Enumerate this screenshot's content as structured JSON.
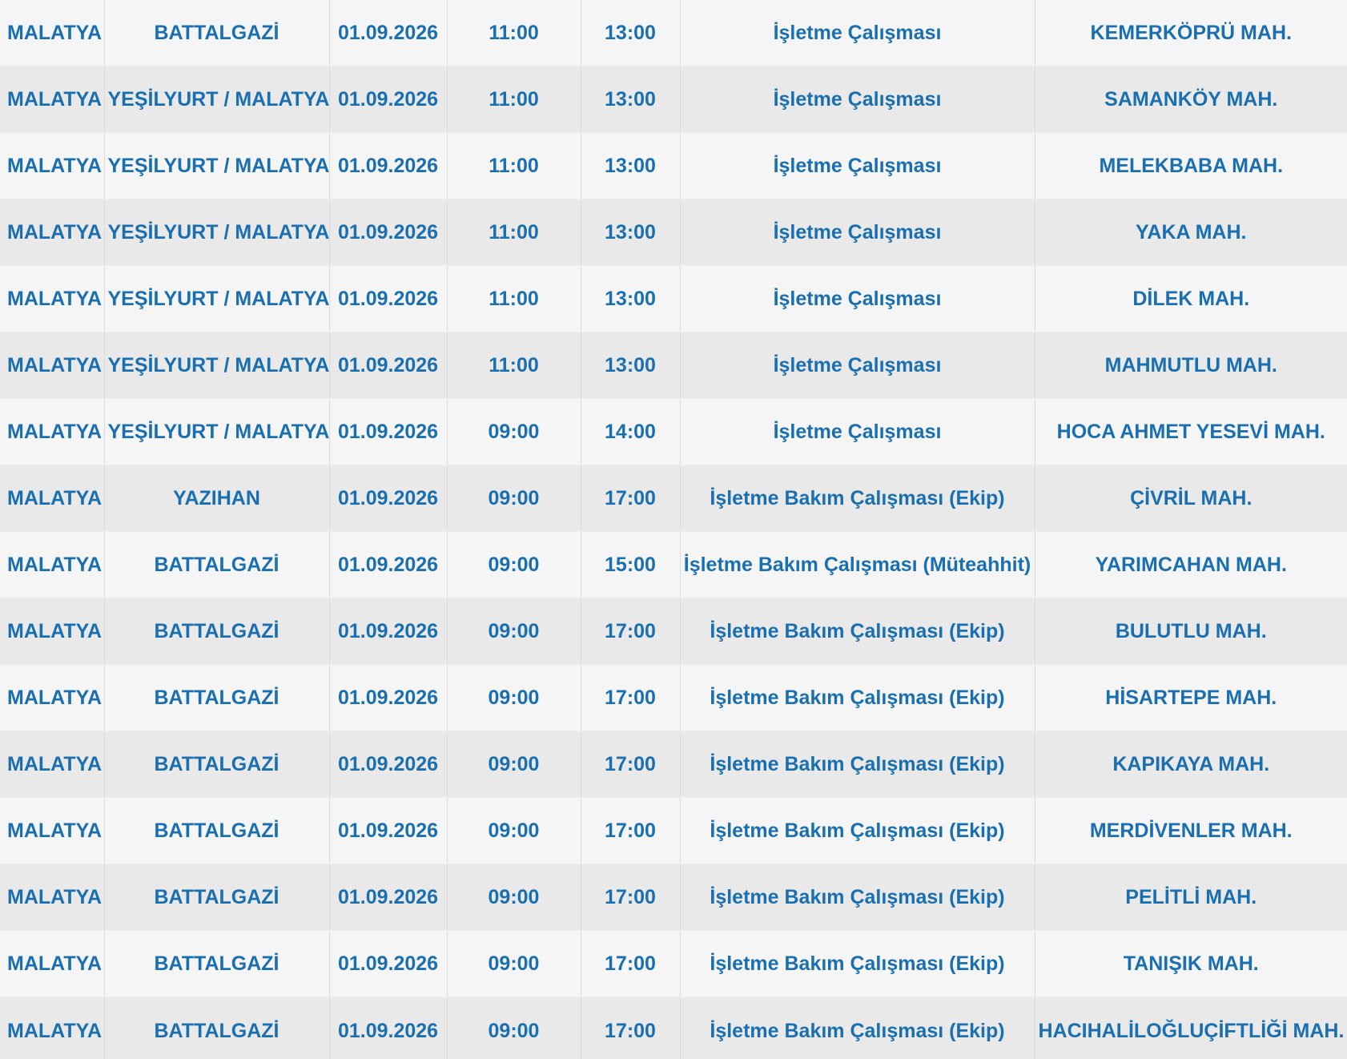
{
  "rows": [
    {
      "city": "MALATYA",
      "district": "BATTALGAZİ",
      "date": "01.09.2026",
      "start": "11:00",
      "end": "13:00",
      "reason": "İşletme Çalışması",
      "neighborhood": "KEMERKÖPRÜ MAH."
    },
    {
      "city": "MALATYA",
      "district": "YEŞİLYURT / MALATYA",
      "date": "01.09.2026",
      "start": "11:00",
      "end": "13:00",
      "reason": "İşletme Çalışması",
      "neighborhood": "SAMANKÖY MAH."
    },
    {
      "city": "MALATYA",
      "district": "YEŞİLYURT / MALATYA",
      "date": "01.09.2026",
      "start": "11:00",
      "end": "13:00",
      "reason": "İşletme Çalışması",
      "neighborhood": "MELEKBABA MAH."
    },
    {
      "city": "MALATYA",
      "district": "YEŞİLYURT / MALATYA",
      "date": "01.09.2026",
      "start": "11:00",
      "end": "13:00",
      "reason": "İşletme Çalışması",
      "neighborhood": "YAKA MAH."
    },
    {
      "city": "MALATYA",
      "district": "YEŞİLYURT / MALATYA",
      "date": "01.09.2026",
      "start": "11:00",
      "end": "13:00",
      "reason": "İşletme Çalışması",
      "neighborhood": "DİLEK MAH."
    },
    {
      "city": "MALATYA",
      "district": "YEŞİLYURT / MALATYA",
      "date": "01.09.2026",
      "start": "11:00",
      "end": "13:00",
      "reason": "İşletme Çalışması",
      "neighborhood": "MAHMUTLU MAH."
    },
    {
      "city": "MALATYA",
      "district": "YEŞİLYURT / MALATYA",
      "date": "01.09.2026",
      "start": "09:00",
      "end": "14:00",
      "reason": "İşletme Çalışması",
      "neighborhood": "HOCA AHMET YESEVİ MAH."
    },
    {
      "city": "MALATYA",
      "district": "YAZIHAN",
      "date": "01.09.2026",
      "start": "09:00",
      "end": "17:00",
      "reason": "İşletme Bakım Çalışması (Ekip)",
      "neighborhood": "ÇİVRİL MAH."
    },
    {
      "city": "MALATYA",
      "district": "BATTALGAZİ",
      "date": "01.09.2026",
      "start": "09:00",
      "end": "15:00",
      "reason": "İşletme Bakım Çalışması (Müteahhit)",
      "neighborhood": "YARIMCAHAN MAH."
    },
    {
      "city": "MALATYA",
      "district": "BATTALGAZİ",
      "date": "01.09.2026",
      "start": "09:00",
      "end": "17:00",
      "reason": "İşletme Bakım Çalışması (Ekip)",
      "neighborhood": "BULUTLU MAH."
    },
    {
      "city": "MALATYA",
      "district": "BATTALGAZİ",
      "date": "01.09.2026",
      "start": "09:00",
      "end": "17:00",
      "reason": "İşletme Bakım Çalışması (Ekip)",
      "neighborhood": "HİSARTEPE MAH."
    },
    {
      "city": "MALATYA",
      "district": "BATTALGAZİ",
      "date": "01.09.2026",
      "start": "09:00",
      "end": "17:00",
      "reason": "İşletme Bakım Çalışması (Ekip)",
      "neighborhood": "KAPIKAYA MAH."
    },
    {
      "city": "MALATYA",
      "district": "BATTALGAZİ",
      "date": "01.09.2026",
      "start": "09:00",
      "end": "17:00",
      "reason": "İşletme Bakım Çalışması (Ekip)",
      "neighborhood": "MERDİVENLER MAH."
    },
    {
      "city": "MALATYA",
      "district": "BATTALGAZİ",
      "date": "01.09.2026",
      "start": "09:00",
      "end": "17:00",
      "reason": "İşletme Bakım Çalışması (Ekip)",
      "neighborhood": "PELİTLİ MAH."
    },
    {
      "city": "MALATYA",
      "district": "BATTALGAZİ",
      "date": "01.09.2026",
      "start": "09:00",
      "end": "17:00",
      "reason": "İşletme Bakım Çalışması (Ekip)",
      "neighborhood": "TANIŞIK MAH."
    },
    {
      "city": "MALATYA",
      "district": "BATTALGAZİ",
      "date": "01.09.2026",
      "start": "09:00",
      "end": "17:00",
      "reason": "İşletme Bakım Çalışması (Ekip)",
      "neighborhood": "HACIHALİLOĞLUÇİFTLİĞİ MAH."
    }
  ],
  "colors": {
    "text": "#1a6fb0",
    "row_light": "#f5f5f5",
    "row_dark": "#e9e9e9",
    "divider": "#dcdcdc"
  }
}
